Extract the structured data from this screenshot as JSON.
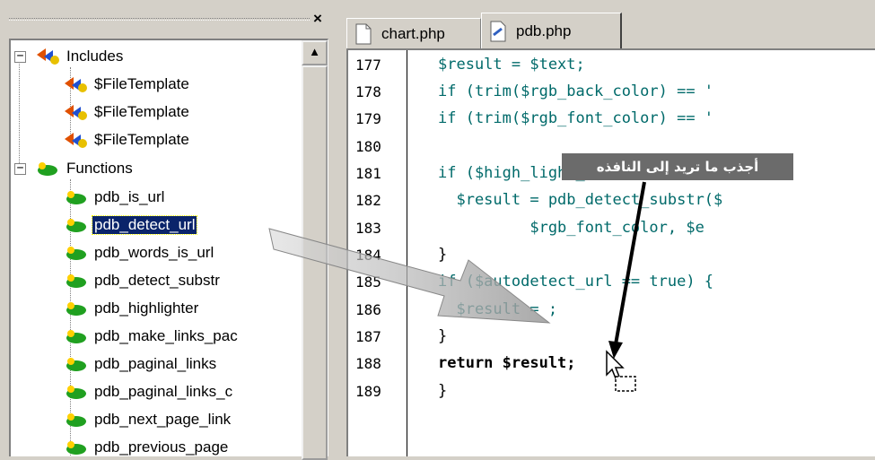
{
  "left_panel": {
    "close_label": "×",
    "tree": {
      "includes": {
        "label": "Includes",
        "expander": "−",
        "children": [
          "$FileTemplate",
          "$FileTemplate",
          "$FileTemplate"
        ]
      },
      "functions": {
        "label": "Functions",
        "expander": "−",
        "children": [
          "pdb_is_url",
          "pdb_detect_url",
          "pdb_words_is_url",
          "pdb_detect_substr",
          "pdb_highlighter",
          "pdb_make_links_pac",
          "pdb_paginal_links",
          "pdb_paginal_links_c",
          "pdb_next_page_link",
          "pdb_previous_page"
        ],
        "selected_index": 1
      }
    },
    "scroll_up_glyph": "▲"
  },
  "editor": {
    "tabs": [
      {
        "label": "chart.php",
        "active": false
      },
      {
        "label": "pdb.php",
        "active": true
      }
    ],
    "lines": [
      {
        "num": "177",
        "code": "$result = $text;"
      },
      {
        "num": "178",
        "code": "if (trim($rgb_back_color) == '"
      },
      {
        "num": "179",
        "code": "if (trim($rgb_font_color) == '"
      },
      {
        "num": "180",
        "code": ""
      },
      {
        "num": "181",
        "code": "if ($high_light_substr == true)"
      },
      {
        "num": "182",
        "code": "  $result = pdb_detect_substr($"
      },
      {
        "num": "183",
        "code": "          $rgb_font_color, $e"
      },
      {
        "num": "184",
        "code": "}"
      },
      {
        "num": "185",
        "code": "if ($autodetect_url == true) {"
      },
      {
        "num": "186",
        "code": "  $result = ;"
      },
      {
        "num": "187",
        "code": "}"
      },
      {
        "num": "188",
        "code": "return $result;"
      },
      {
        "num": "189",
        "code": "}"
      }
    ]
  },
  "tooltip": {
    "text": "أجذب ما تريد إلى النافذه"
  },
  "colors": {
    "selection": "#0a246a",
    "variable": "#006a6a",
    "string": "#c00000",
    "tooltip_bg": "#6b6b6b"
  }
}
